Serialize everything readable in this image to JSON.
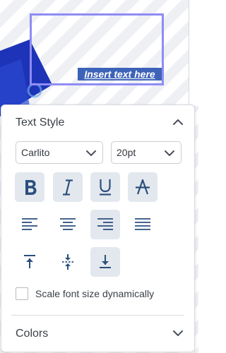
{
  "canvas": {
    "textbox_text": "Insert text here"
  },
  "text_style": {
    "title": "Text Style",
    "font_family": "Carlito",
    "font_size": "20pt",
    "format_buttons": [
      {
        "name": "bold",
        "selected": true
      },
      {
        "name": "italic",
        "selected": true
      },
      {
        "name": "underline",
        "selected": true
      },
      {
        "name": "strikethrough",
        "selected": true
      }
    ],
    "horizontal_align": {
      "options": [
        "left",
        "center",
        "right",
        "justify"
      ],
      "selected": "right"
    },
    "vertical_align": {
      "options": [
        "top",
        "middle",
        "bottom"
      ],
      "selected": "bottom"
    },
    "scale_font": {
      "label": "Scale font size dynamically",
      "checked": false
    }
  },
  "colors": {
    "title": "Colors"
  },
  "theme": {
    "icon_color": "#2b4f7c",
    "selected_bg": "#e3e8ef",
    "textbox_border": "#8f8cf5",
    "text_highlight": "#3d63b8"
  }
}
